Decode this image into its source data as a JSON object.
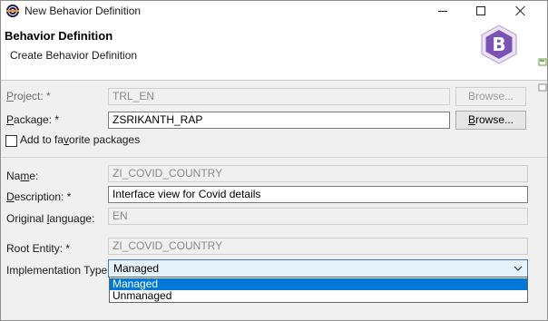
{
  "window": {
    "title": "New Behavior Definition",
    "controls": {
      "minimize": "minimize",
      "maximize": "maximize",
      "close": "close"
    }
  },
  "banner": {
    "title": "Behavior Definition",
    "subtitle": "Create Behavior Definition",
    "logo_letter": "B"
  },
  "form": {
    "project": {
      "label_pre": "",
      "label_u": "P",
      "label_post": "roject: *",
      "value": "TRL_EN",
      "button": "Browse..."
    },
    "package": {
      "label_pre": "",
      "label_u": "P",
      "label_post": "ackage: *",
      "value": "ZSRIKANTH_RAP",
      "button_pre": "",
      "button_u": "B",
      "button_post": "rowse..."
    },
    "favorite": {
      "label_pre": "Add to fa",
      "label_u": "v",
      "label_post": "orite packages",
      "checked": false
    },
    "name": {
      "label_pre": "Na",
      "label_u": "m",
      "label_post": "e:",
      "value": "ZI_COVID_COUNTRY"
    },
    "description": {
      "label_pre": "",
      "label_u": "D",
      "label_post": "escription: *",
      "value": "Interface view for Covid details"
    },
    "original_language": {
      "label_pre": "Original ",
      "label_u": "l",
      "label_post": "anguage:",
      "value": "EN"
    },
    "root_entity": {
      "label": "Root Entity: *",
      "value": "ZI_COVID_COUNTRY"
    },
    "implementation_type": {
      "label": "Implementation Type: *",
      "value": "Managed",
      "options": [
        "Managed",
        "Unmanaged"
      ],
      "selected_index": 0
    }
  },
  "colors": {
    "accent": "#0078d7",
    "combo_focus_border": "#4a79c8",
    "combo_background": "#e5f1fb",
    "logo_purple": "#7b53b5"
  }
}
